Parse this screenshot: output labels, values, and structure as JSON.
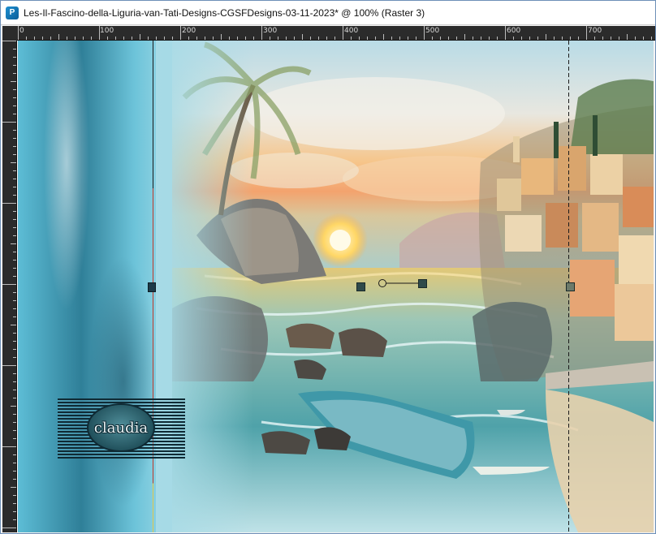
{
  "window": {
    "title": "Les-Il-Fascino-della-Liguria-van-Tati-Designs-CGSFDesigns-03-11-2023* @ 100% (Raster 3)"
  },
  "ruler": {
    "labels": [
      "0",
      "100",
      "200",
      "300",
      "400",
      "500",
      "600",
      "700"
    ]
  },
  "canvas": {
    "watermark": "claudia"
  },
  "colors": {
    "ruler_bg": "#2b2b2b",
    "guide_red": "#c0392b",
    "guide_dark": "#1b1b1b",
    "accent": "#1d8fd1"
  },
  "icons": {
    "app": "paint-shop-icon",
    "rotation_handle": "rotation-handle-icon"
  }
}
